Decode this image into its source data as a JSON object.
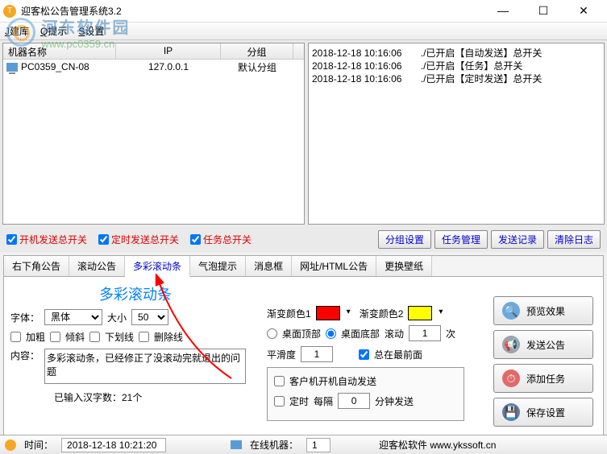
{
  "window": {
    "title": "迎客松公告管理系统3.2",
    "min": "—",
    "max": "☐",
    "close": "✕"
  },
  "watermark": {
    "cn": "河东软件园",
    "url": "www.pc0359.cn"
  },
  "menu": {
    "sqlku": "Q提示",
    "tip_prefix_q": "Q",
    "tip_text": "提示",
    "set_prefix_s": "S",
    "set_text": "设置"
  },
  "menubar_items": [
    "J建库",
    "Q提示",
    "S设置"
  ],
  "grid": {
    "cols": {
      "name": "机器名称",
      "ip": "IP",
      "group": "分组"
    },
    "row1": {
      "name": "PC0359_CN-08",
      "ip": "127.0.0.1",
      "group": "默认分组"
    }
  },
  "log": [
    "2018-12-18 10:16:06       ./已开启【自动发送】总开关",
    "2018-12-18 10:16:06       ./已开启【任务】总开关",
    "2018-12-18 10:16:06       ./已开启【定时发送】总开关"
  ],
  "switches": {
    "boot": "开机发送总开关",
    "timed": "定时发送总开关",
    "task": "任务总开关"
  },
  "buttons_mid": {
    "group": "分组设置",
    "task": "任务管理",
    "record": "发送记录",
    "clear": "清除日志"
  },
  "tabs": {
    "t1": "右下角公告",
    "t2": "滚动公告",
    "t3": "多彩滚动条",
    "t4": "气泡提示",
    "t5": "消息框",
    "t6": "网址/HTML公告",
    "t7": "更换壁纸"
  },
  "panel": {
    "heading": "多彩滚动条",
    "font_lbl": "字体：",
    "font_val": "黑体",
    "size_lbl": "大小",
    "size_val": "50",
    "bold": "加粗",
    "italic": "倾斜",
    "underline": "下划线",
    "strike": "删除线",
    "content_lbl": "内容：",
    "content_val": "多彩滚动条，已经修正了没滚动完就退出的问题",
    "footnote": "已输入汉字数：21个",
    "grad1": "渐变颜色1",
    "grad1_color": "#ff0000",
    "grad2": "渐变颜色2",
    "grad2_color": "#ffff00",
    "pos_top": "桌面顶部",
    "pos_bottom": "桌面底部",
    "scroll_lbl": "滚动",
    "scroll_val": "1",
    "scroll_unit": "次",
    "smooth_lbl": "平滑度",
    "smooth_val": "1",
    "topmost": "总在最前面",
    "auto_send": "客户机开机自动发送",
    "timed_chk": "定时",
    "interval_lbl": "每隔",
    "interval_val": "0",
    "interval_unit": "分钟发送"
  },
  "big_buttons": {
    "preview": "预览效果",
    "send": "发送公告",
    "addtask": "添加任务",
    "save": "保存设置"
  },
  "status": {
    "time_lbl": "时间：",
    "time_val": "2018-12-18 10:21:20",
    "online_lbl": "在线机器：",
    "online_val": "1",
    "brand": "迎客松软件 www.ykssoft.cn"
  }
}
